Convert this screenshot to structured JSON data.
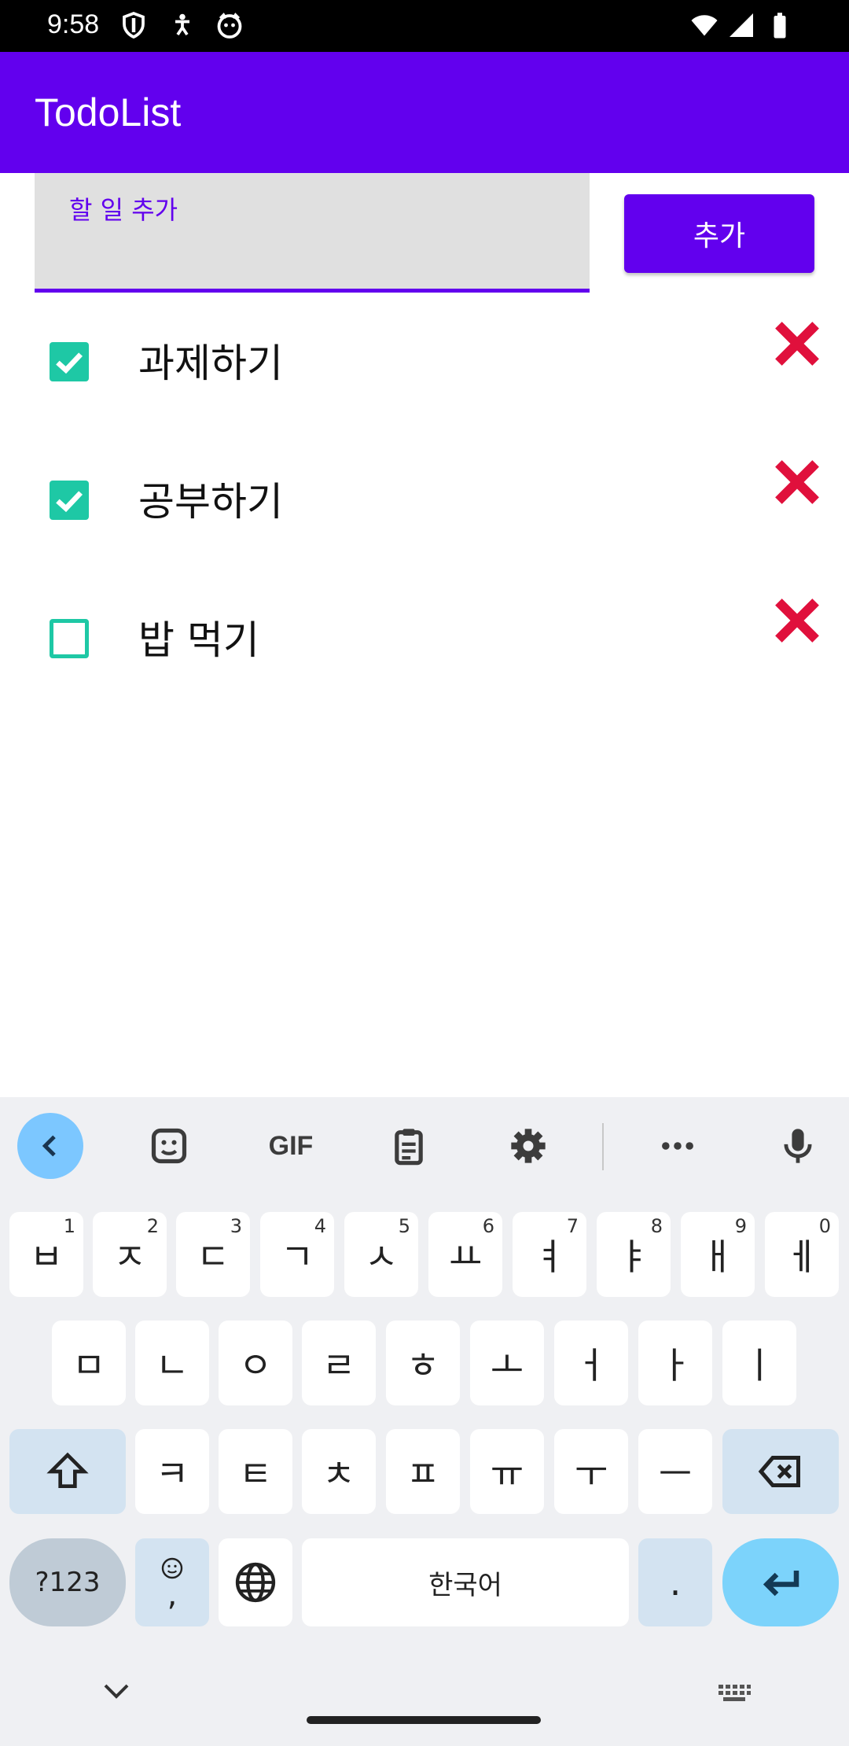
{
  "status_bar": {
    "time": "9:58",
    "icons_left": [
      "shield-icon",
      "accessibility-icon",
      "cat-face-icon"
    ],
    "icons_right": [
      "wifi-icon",
      "signal-icon",
      "battery-icon"
    ]
  },
  "app_bar": {
    "title": "TodoList"
  },
  "new_todo": {
    "placeholder": "할 일 추가",
    "value": "",
    "add_label": "추가"
  },
  "todos": [
    {
      "label": "과제하기",
      "checked": true
    },
    {
      "label": "공부하기",
      "checked": true
    },
    {
      "label": "밥 먹기",
      "checked": false
    }
  ],
  "keyboard": {
    "toolbar": [
      "back-icon",
      "sticker-icon",
      "gif-icon",
      "clipboard-icon",
      "gear-icon",
      "more-icon",
      "mic-icon"
    ],
    "gif_label": "GIF",
    "row1": [
      {
        "key": "ㅂ",
        "num": "1"
      },
      {
        "key": "ㅈ",
        "num": "2"
      },
      {
        "key": "ㄷ",
        "num": "3"
      },
      {
        "key": "ㄱ",
        "num": "4"
      },
      {
        "key": "ㅅ",
        "num": "5"
      },
      {
        "key": "ㅛ",
        "num": "6"
      },
      {
        "key": "ㅕ",
        "num": "7"
      },
      {
        "key": "ㅑ",
        "num": "8"
      },
      {
        "key": "ㅐ",
        "num": "9"
      },
      {
        "key": "ㅔ",
        "num": "0"
      }
    ],
    "row2": [
      "ㅁ",
      "ㄴ",
      "ㅇ",
      "ㄹ",
      "ㅎ",
      "ㅗ",
      "ㅓ",
      "ㅏ",
      "ㅣ"
    ],
    "row3": [
      "ㅋ",
      "ㅌ",
      "ㅊ",
      "ㅍ",
      "ㅠ",
      "ㅜ",
      "ㅡ"
    ],
    "symbols_label": "?123",
    "emoji_comma_label": ",",
    "space_label": "한국어",
    "period_label": "."
  },
  "colors": {
    "primary": "#6200ee",
    "checkbox": "#1ec8a5",
    "delete": "#e0103c",
    "keyboard_bg": "#eff0f3"
  }
}
